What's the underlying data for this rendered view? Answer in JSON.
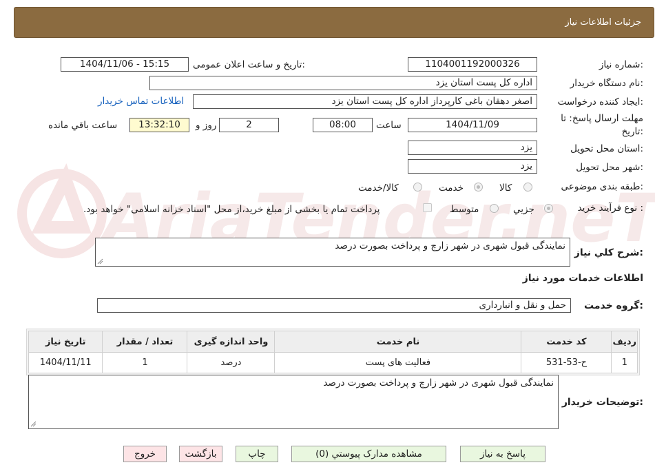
{
  "header": {
    "title": "جزئیات اطلاعات نیاز"
  },
  "form": {
    "need_number_label": "شماره نیاز:",
    "need_number": "1104001192000326",
    "announce_label": "تاریخ و ساعت اعلان عمومی:",
    "announce_value": "1404/11/06 - 15:15",
    "buyer_org_label": "نام دستگاه خریدار:",
    "buyer_org": "اداره کل پست استان یزد",
    "requester_label": "ایجاد کننده درخواست:",
    "requester": "اصغر دهقان باغی کارپرداز اداره کل پست استان یزد",
    "contact_link": "اطلاعات تماس خریدار",
    "deadline_label_1": "مهلت ارسال پاسخ: تا",
    "deadline_label_2": "تاریخ:",
    "deadline_date": "1404/11/09",
    "time_label": "ساعت",
    "deadline_time": "08:00",
    "days_value": "2",
    "days_label": "روز و",
    "remaining_time": "13:32:10",
    "remaining_label": "ساعت باقي مانده",
    "province_label": "استان محل تحویل:",
    "province": "یزد",
    "city_label": "شهر محل تحویل:",
    "city": "یزد",
    "category_label": "طبقه بندی موضوعی:",
    "category_options": [
      "کالا",
      "خدمت",
      "کالا/خدمت"
    ],
    "category_selected": "خدمت",
    "process_label": "نوع فرآیند خرید :",
    "process_options": [
      "جزيي",
      "متوسط"
    ],
    "process_selected": "جزيي",
    "treasury_note": "پرداخت تمام یا بخشی از مبلغ خرید،از محل \"اسناد خزانه اسلامی\" خواهد بود."
  },
  "summary": {
    "label": "شرح کلي نياز:",
    "text": "نمایندگی قبول شهری در شهر زارچ و پرداخت بصورت درصد"
  },
  "services": {
    "section_title": "اطلاعات خدمات مورد نیاز",
    "group_label": "گروه خدمت:",
    "group_value": "حمل و نقل و انبارداری",
    "columns": [
      "ردیف",
      "کد خدمت",
      "نام خدمت",
      "واحد اندازه گیری",
      "تعداد / مقدار",
      "تاریخ نیاز"
    ],
    "rows": [
      {
        "row": "1",
        "code": "ح-53-531",
        "name": "فعالیت های پست",
        "unit": "درصد",
        "qty": "1",
        "date": "1404/11/11"
      }
    ]
  },
  "buyer_notes": {
    "label": "توضیحات خریدار:",
    "text": "نمایندگی قبول شهری در شهر زارچ و پرداخت بصورت درصد"
  },
  "buttons": {
    "reply": "پاسخ به نیاز",
    "attachments": "مشاهده مدارک پیوستي (0)",
    "print": "چاپ",
    "back": "بازگشت",
    "exit": "خروج"
  },
  "watermark": {
    "text": "AriaTender.neT",
    "color": "#f3dddd"
  }
}
